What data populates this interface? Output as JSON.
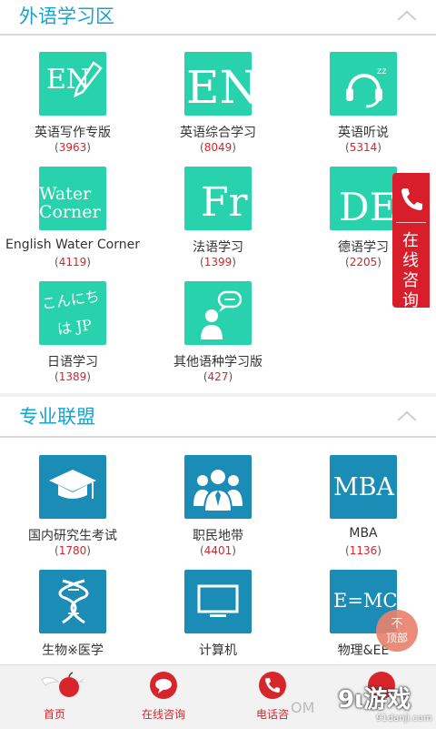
{
  "sections": [
    {
      "title": "外语学习区",
      "items": [
        {
          "name": "英语写作专版",
          "count": "3963",
          "glyph": "EN"
        },
        {
          "name": "英语综合学习",
          "count": "8049",
          "glyph": "EN"
        },
        {
          "name": "英语听说",
          "count": "5314",
          "glyph": ""
        },
        {
          "name": "English Water Corner",
          "count": "4119",
          "glyph": "Water Corner"
        },
        {
          "name": "法语学习",
          "count": "1399",
          "glyph": "Fr"
        },
        {
          "name": "德语学习",
          "count": "2205",
          "glyph": "DE"
        },
        {
          "name": "日语学习",
          "count": "1389",
          "glyph": "こんにちは JP"
        },
        {
          "name": "其他语种学习版",
          "count": "427",
          "glyph": ""
        }
      ]
    },
    {
      "title": "专业联盟",
      "items": [
        {
          "name": "国内研究生考试",
          "count": "1780",
          "glyph": ""
        },
        {
          "name": "职民地带",
          "count": "4401",
          "glyph": ""
        },
        {
          "name": "MBA",
          "count": "1136",
          "glyph": "MBA"
        },
        {
          "name": "生物※医学",
          "count": "",
          "glyph": ""
        },
        {
          "name": "计算机",
          "count": "",
          "glyph": ""
        },
        {
          "name": "物理&EE",
          "count": "",
          "glyph": "E=MC²"
        }
      ]
    }
  ],
  "float_consult": {
    "text": "在线咨询"
  },
  "to_top": {
    "top": "不",
    "bottom": "顶部"
  },
  "bottom_nav": [
    {
      "label": "首页",
      "icon": "apple-wings-icon"
    },
    {
      "label": "在线咨询",
      "icon": "chat-bubble-icon"
    },
    {
      "label": "电话咨",
      "icon": "phone-icon"
    },
    {
      "label": "",
      "icon": "partial-icon"
    }
  ],
  "watermark": {
    "logo": "9ι游戏",
    "url": "91danji.com",
    "om": "OM"
  },
  "colors": {
    "accent": "#17a3cf",
    "green_tile": "#27d2ac",
    "blue_tile": "#1a8cb5",
    "red": "#d81e2a"
  }
}
